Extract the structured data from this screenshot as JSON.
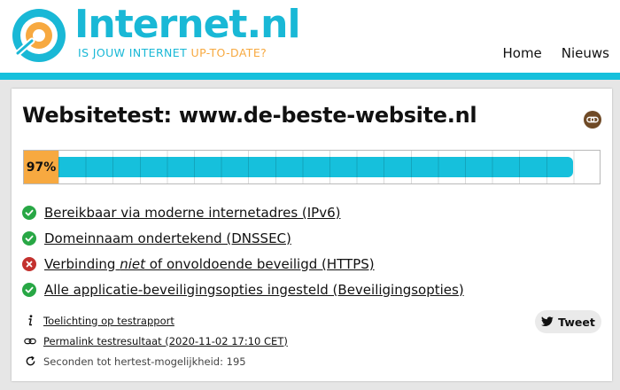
{
  "header": {
    "logo_name": "Internet.nl",
    "tagline_part1": "IS JOUW INTERNET ",
    "tagline_part2": "UP-TO-DATE?",
    "nav": [
      {
        "label": "Home"
      },
      {
        "label": "Nieuws"
      }
    ]
  },
  "colors": {
    "brand_cyan": "#16c0dc",
    "brand_orange": "#f7a940",
    "pass_green": "#28a745",
    "fail_red": "#c3312e",
    "permalink_brown": "#6f4a26"
  },
  "test": {
    "title": "Websitetest: www.de-beste-website.nl",
    "score_label": "97%",
    "score_fraction": 0.97,
    "permalink_icon": "link-icon"
  },
  "results": [
    {
      "status": "pass",
      "icon": "check-circle-icon",
      "label": "Bereikbaar via moderne internetadres (IPv6)"
    },
    {
      "status": "pass",
      "icon": "check-circle-icon",
      "label": "Domeinnaam ondertekend (DNSSEC)"
    },
    {
      "status": "fail",
      "icon": "cross-circle-icon",
      "label_before": "Verbinding ",
      "label_em": "niet",
      "label_after": " of onvoldoende beveiligd (HTTPS)"
    },
    {
      "status": "pass",
      "icon": "check-circle-icon",
      "label": "Alle applicatie-beveiligingsopties ingesteld (Beveiligingsopties)"
    }
  ],
  "meta": {
    "explanation_label": "Toelichting op testrapport",
    "permalink_label": "Permalink testresultaat (2020-11-02 17:10 CET)",
    "retest_label": "Seconden tot hertest-mogelijkheid: 195"
  },
  "tweet": {
    "label": "Tweet",
    "icon": "twitter-icon"
  }
}
